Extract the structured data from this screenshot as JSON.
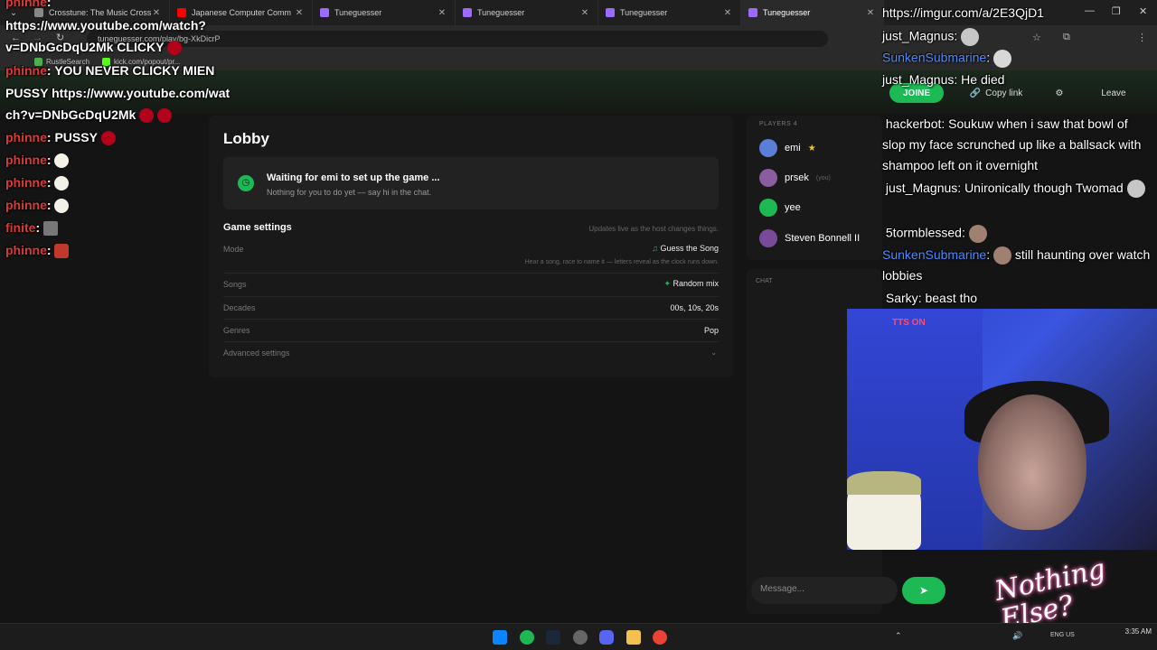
{
  "browser": {
    "tabs": [
      {
        "title": "Crosstune: The Music Crossword",
        "color": "#888888"
      },
      {
        "title": "Japanese Computer Comm",
        "color": "#ff0000"
      },
      {
        "title": "Tuneguesser",
        "color": "#9b6bff"
      },
      {
        "title": "Tuneguesser",
        "color": "#9b6bff"
      },
      {
        "title": "Tuneguesser",
        "color": "#9b6bff"
      },
      {
        "title": "Tuneguesser",
        "color": "#9b6bff",
        "active": true
      }
    ],
    "address": "tuneguesser.com/play/bg-XkDicrP",
    "bookmarks": [
      "RustleSearch",
      "kick.com/popout/pr..."
    ]
  },
  "header": {
    "join_label": "JOINE",
    "copy_label": "Copy link",
    "leave_label": "Leave"
  },
  "lobby": {
    "title": "Lobby",
    "wait_title": "Waiting for emi to set up the game ...",
    "wait_sub": "Nothing for you to do yet — say hi in the chat.",
    "settings_title": "Game settings",
    "settings_note": "Updates live as the host changes things.",
    "mode_label": "Mode",
    "mode_value": "Guess the Song",
    "mode_desc": "Hear a song, race to name it — letters reveal as the clock runs down.",
    "songs_label": "Songs",
    "songs_value": "Random mix",
    "decades_label": "Decades",
    "decades_value": "00s, 10s, 20s",
    "genres_label": "Genres",
    "genres_value": "Pop",
    "advanced_label": "Advanced settings"
  },
  "players": {
    "title": "PLAYERS 4",
    "list": [
      {
        "name": "emi",
        "host": true,
        "color": "#5b7fd6"
      },
      {
        "name": "prsek",
        "you": "(you)",
        "color": "#8a5ca0"
      },
      {
        "name": "yee",
        "color": "#1db954"
      },
      {
        "name": "Steven Bonnell II",
        "color": "#7a4a9a"
      }
    ]
  },
  "chat": {
    "title": "CHAT",
    "placeholder": "Message..."
  },
  "stream_left": [
    {
      "name": "phinne",
      "text": ""
    },
    {
      "name": "",
      "text": "https://www.youtube.com/watch?"
    },
    {
      "name": "",
      "text": "v=DNbGcDqU2Mk CLICKY"
    },
    {
      "name": "phinne",
      "text": "YOU NEVER CLICKY MIEN"
    },
    {
      "name": "",
      "text": "PUSSY https://www.youtube.com/wat"
    },
    {
      "name": "",
      "text": "ch?v=DNbGcDqU2Mk"
    },
    {
      "name": "phinne",
      "text": "PUSSY"
    },
    {
      "name": "phinne",
      "text": ""
    },
    {
      "name": "phinne",
      "text": ""
    },
    {
      "name": "phinne",
      "text": ""
    },
    {
      "name": "finite",
      "text": ""
    },
    {
      "name": "phinne",
      "text": ""
    }
  ],
  "stream_right": {
    "link": "https://imgur.com/a/2E3QjD1",
    "lines": [
      {
        "name": "just_Magnus",
        "text": ""
      },
      {
        "name": "SunkenSubmarine",
        "text": "",
        "blue": true
      },
      {
        "name": "just_Magnus",
        "text": "He died"
      },
      {
        "name": "hackerbot",
        "text": "Soukuw when i saw that bowl of slop my face scrunched up like a ballsack with shampoo left on it overnight"
      },
      {
        "name": "just_Magnus",
        "text": "Unironically though Twomad"
      },
      {
        "name": "5tormblessed",
        "text": ""
      },
      {
        "name": "SunkenSubmarine",
        "text": "still haunting over watch lobbies",
        "blue": true
      },
      {
        "name": "Sarky",
        "text": "beast tho"
      }
    ],
    "tts_label": "TTS ON",
    "logo_text": "Nothing Else?"
  },
  "taskbar": {
    "lang": "ENG US",
    "time": "3:35 AM"
  }
}
